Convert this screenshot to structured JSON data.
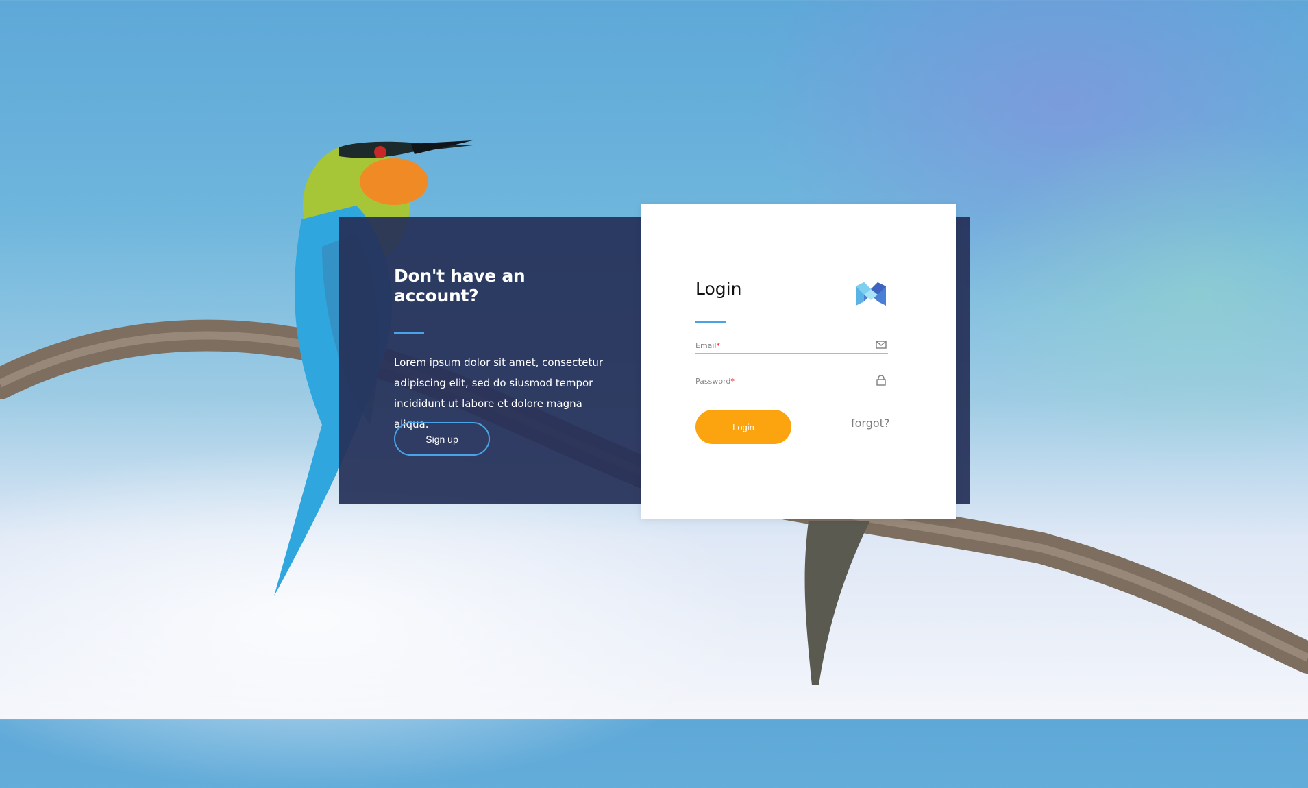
{
  "signup_panel": {
    "title": "Don't have an account?",
    "body": "Lorem ipsum dolor sit amet, consectetur adipiscing elit, sed do siusmod tempor incididunt ut labore et dolore magna aliqua.",
    "button_label": "Sign up"
  },
  "login_card": {
    "title": "Login",
    "email_label": "Email",
    "password_label": "Password",
    "required_mark": "*",
    "login_button": "Login",
    "forgot_link": "forgot?"
  },
  "icons": {
    "email": "envelope-icon",
    "password": "lock-icon",
    "logo": "brand-logo-icon"
  },
  "colors": {
    "panel": "#263058",
    "accent_blue": "#4aa3e6",
    "login_button": "#fca410",
    "required": "#e52b2b"
  }
}
